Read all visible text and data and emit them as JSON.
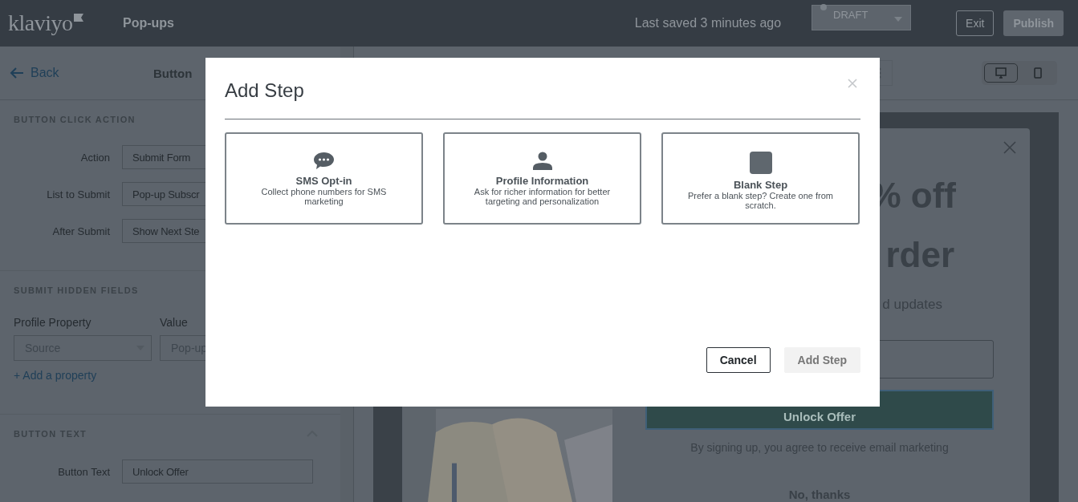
{
  "topbar": {
    "logo": "klaviyo",
    "title": "Pop-ups",
    "save_status": "Last saved 3 minutes ago",
    "status_dropdown": "DRAFT",
    "buttons": [
      "Exit",
      "Publish"
    ]
  },
  "sidebar": {
    "back": "Back",
    "title": "Button",
    "sections": [
      {
        "kind": "form",
        "heading": "BUTTON CLICK ACTION",
        "fields": [
          {
            "label": "Action",
            "value": "Submit Form"
          },
          {
            "label": "List to Submit",
            "value": "Pop-up Subscr"
          },
          {
            "label": "After Submit",
            "value": "Show Next Ste"
          }
        ]
      },
      {
        "kind": "hidden",
        "heading": "SUBMIT HIDDEN FIELDS",
        "columns": [
          "Profile Property",
          "Value"
        ],
        "property": "Source",
        "value": "Pop-up",
        "add_link": "+ Add a property"
      },
      {
        "kind": "form",
        "heading": "BUTTON TEXT",
        "expanded": true,
        "fields": [
          {
            "label": "Button Text",
            "value": "Unlock Offer"
          }
        ]
      }
    ]
  },
  "toolbar": {
    "devices": [
      {
        "kind": "desktop",
        "selected": true
      },
      {
        "kind": "mobile",
        "selected": false
      }
    ]
  },
  "preview": {
    "headline_lines": [
      "% off",
      "rder"
    ],
    "subtitle": "d updates",
    "button": "Unlock Offer",
    "disclaimer": "By signing up, you agree to receive email marketing",
    "decline": "No, thanks"
  },
  "modal": {
    "title": "Add Step",
    "options": [
      {
        "kind": "sms",
        "title": "SMS Opt-in",
        "description": "Collect phone numbers for SMS marketing",
        "selected": false
      },
      {
        "kind": "profile",
        "title": "Profile Information",
        "description": "Ask for richer information for better targeting and personalization",
        "selected": false
      },
      {
        "kind": "blank",
        "title": "Blank Step",
        "description": "Prefer a blank step? Create one from scratch.",
        "selected": false
      }
    ],
    "buttons": [
      {
        "label": "Cancel",
        "disabled": false
      },
      {
        "label": "Add Step",
        "disabled": true
      }
    ]
  }
}
